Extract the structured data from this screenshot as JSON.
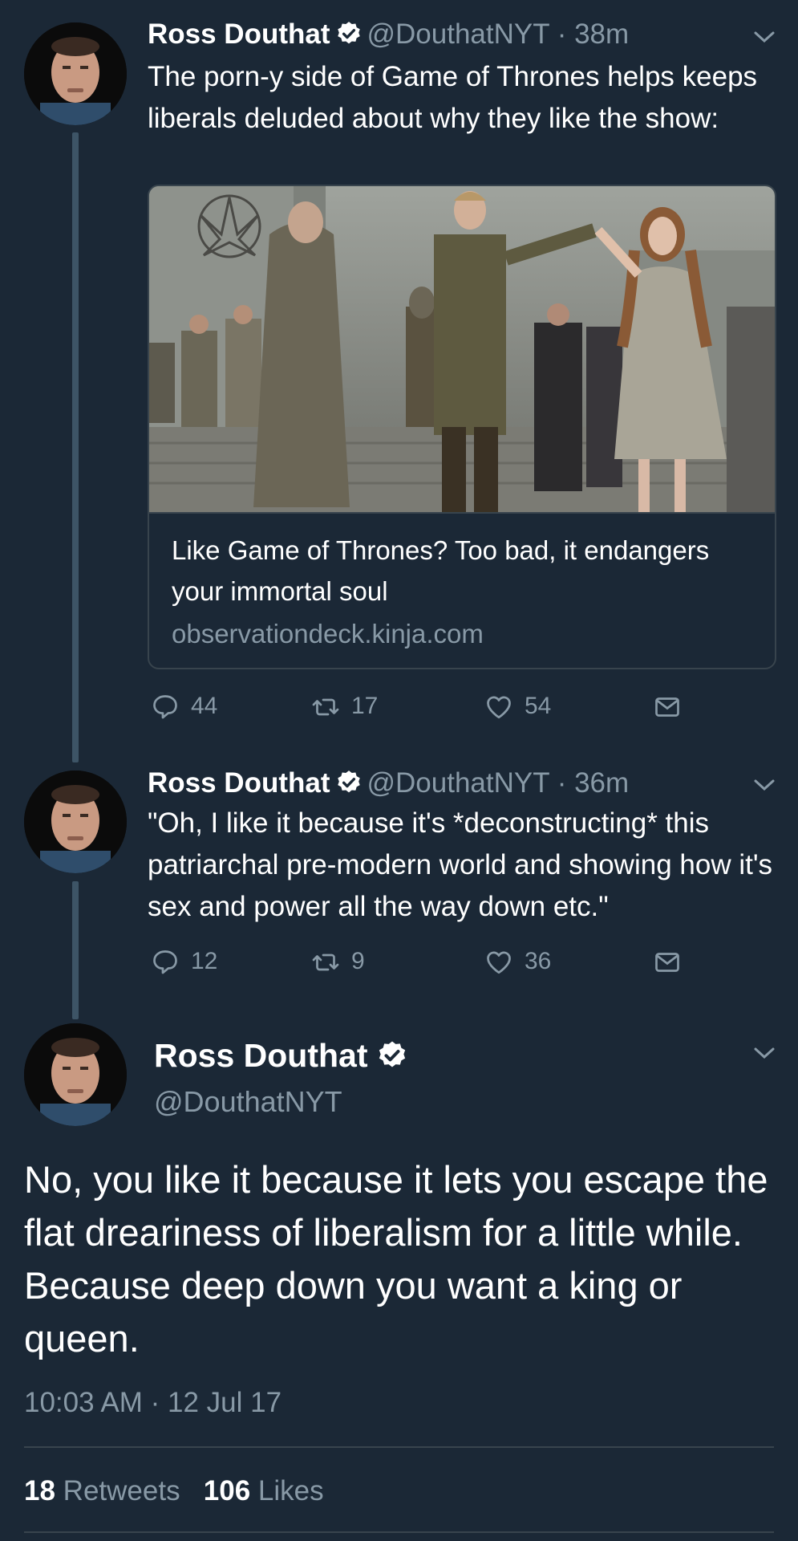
{
  "tweets": [
    {
      "name": "Ross Douthat",
      "handle": "@DouthatNYT",
      "time": "38m",
      "text": "The porn-y side of Game of Thrones helps keeps liberals deluded about why they like the show:",
      "card": {
        "title": "Like Game of Thrones? Too bad, it endangers your immortal soul",
        "domain": "observationdeck.kinja.com"
      },
      "replies": "44",
      "retweets": "17",
      "likes": "54"
    },
    {
      "name": "Ross Douthat",
      "handle": "@DouthatNYT",
      "time": "36m",
      "text": "\"Oh, I like it because it's *deconstructing* this patriarchal pre-modern world and showing how it's sex and power all the way down etc.\"",
      "replies": "12",
      "retweets": "9",
      "likes": "36"
    }
  ],
  "main": {
    "name": "Ross Douthat",
    "handle": "@DouthatNYT",
    "text": "No, you like it because it lets you escape the flat dreariness of liberalism for a little while. Because deep down you want a king or queen.",
    "timestamp": "10:03 AM · 12 Jul 17",
    "retweets_count": "18",
    "retweets_label": "Retweets",
    "likes_count": "106",
    "likes_label": "Likes"
  },
  "colors": {
    "background": "#1b2836",
    "secondary_text": "#8899a6",
    "verified": "#ffffff",
    "thread_line": "#3d5466"
  },
  "icons": [
    "reply-icon",
    "retweet-icon",
    "like-icon",
    "dm-icon",
    "verified-badge-icon",
    "chevron-down-icon"
  ]
}
